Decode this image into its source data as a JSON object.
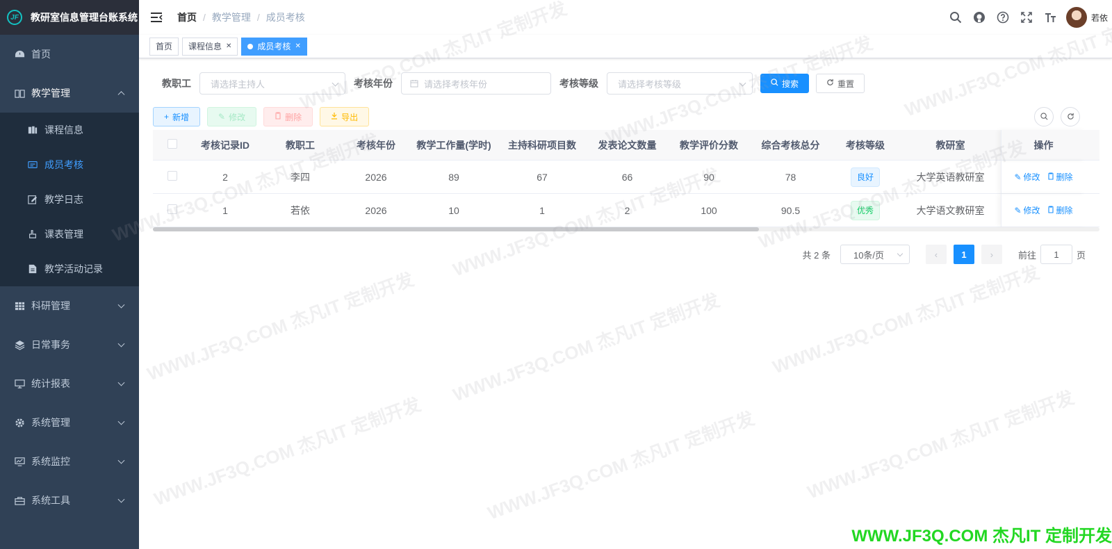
{
  "app": {
    "title": "教研室信息管理台账系统",
    "logo_text": "JF"
  },
  "sidebar": {
    "items": [
      {
        "label": "首页",
        "icon": "dashboard-icon"
      },
      {
        "label": "教学管理",
        "icon": "book-icon",
        "open": true,
        "children": [
          {
            "label": "课程信息",
            "icon": "course-icon"
          },
          {
            "label": "成员考核",
            "icon": "assessment-icon",
            "active": true
          },
          {
            "label": "教学日志",
            "icon": "edit-icon"
          },
          {
            "label": "课表管理",
            "icon": "hand-icon"
          },
          {
            "label": "教学活动记录",
            "icon": "document-icon"
          }
        ]
      },
      {
        "label": "科研管理",
        "icon": "table-icon"
      },
      {
        "label": "日常事务",
        "icon": "layers-icon"
      },
      {
        "label": "统计报表",
        "icon": "monitor-icon"
      },
      {
        "label": "系统管理",
        "icon": "gear-icon"
      },
      {
        "label": "系统监控",
        "icon": "monitor-chart-icon"
      },
      {
        "label": "系统工具",
        "icon": "toolbox-icon"
      }
    ]
  },
  "navbar": {
    "breadcrumb": [
      "首页",
      "教学管理",
      "成员考核"
    ],
    "username": "若依"
  },
  "tags": [
    {
      "label": "首页",
      "closable": false
    },
    {
      "label": "课程信息",
      "closable": true
    },
    {
      "label": "成员考核",
      "closable": true,
      "active": true
    }
  ],
  "search": {
    "staff_label": "教职工",
    "staff_placeholder": "请选择主持人",
    "year_label": "考核年份",
    "year_placeholder": "请选择考核年份",
    "level_label": "考核等级",
    "level_placeholder": "请选择考核等级",
    "search_btn": "搜索",
    "reset_btn": "重置"
  },
  "toolbar": {
    "add": "新增",
    "edit": "修改",
    "delete": "删除",
    "export": "导出"
  },
  "table": {
    "headers": [
      "考核记录ID",
      "教职工",
      "考核年份",
      "教学工作量(学时)",
      "主持科研项目数",
      "发表论文数量",
      "教学评价分数",
      "综合考核总分",
      "考核等级",
      "教研室",
      "操作"
    ],
    "rows": [
      {
        "id": "2",
        "staff": "李四",
        "year": "2026",
        "workload": "89",
        "projects": "67",
        "papers": "66",
        "eval": "90",
        "total": "78",
        "level": "良好",
        "dept": "大学英语教研室"
      },
      {
        "id": "1",
        "staff": "若依",
        "year": "2026",
        "workload": "10",
        "projects": "1",
        "papers": "2",
        "eval": "100",
        "total": "90.5",
        "level": "优秀",
        "dept": "大学语文教研室"
      }
    ],
    "op_edit": "修改",
    "op_delete": "删除",
    "scroll_fraction": 0.64
  },
  "pagination": {
    "total_text": "共 2 条",
    "page_size": "10条/页",
    "current_page": "1",
    "goto_label": "前往",
    "goto_value": "1",
    "page_suffix": "页"
  },
  "watermark": {
    "text": "WWW.JF3Q.COM 杰凡IT 定制开发",
    "footer": "WWW.JF3Q.COM 杰凡IT  定制开发",
    "footer_color": "#22d722"
  }
}
